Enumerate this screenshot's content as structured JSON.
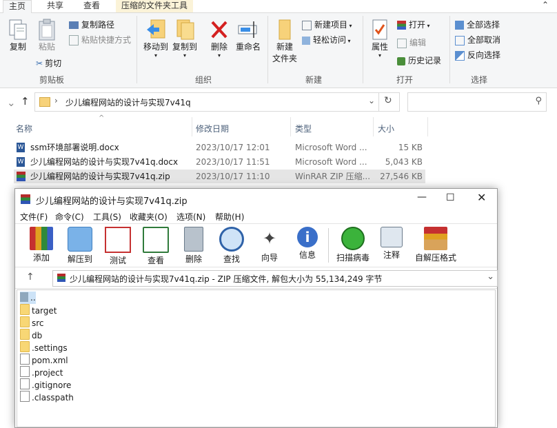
{
  "ribbon": {
    "tabs": [
      "主页",
      "共享",
      "查看",
      "压缩的文件夹工具"
    ],
    "clipboard": {
      "copy": "复制",
      "paste": "粘贴",
      "copy_path": "复制路径",
      "paste_shortcut": "粘贴快捷方式",
      "cut": "剪切",
      "group": "剪贴板"
    },
    "organize": {
      "move_to": "移动到",
      "copy_to": "复制到",
      "delete": "删除",
      "rename": "重命名",
      "group": "组织"
    },
    "new": {
      "new_folder_1": "新建",
      "new_folder_2": "文件夹",
      "new_item": "新建项目",
      "easy_access": "轻松访问",
      "group": "新建"
    },
    "open": {
      "properties": "属性",
      "open": "打开",
      "edit": "编辑",
      "history": "历史记录",
      "group": "打开"
    },
    "select": {
      "select_all": "全部选择",
      "select_none": "全部取消",
      "invert": "反向选择",
      "group": "选择"
    }
  },
  "address": {
    "path": "少儿编程网站的设计与实现7v41q"
  },
  "columns": {
    "name": "名称",
    "date": "修改日期",
    "type": "类型",
    "size": "大小"
  },
  "files": [
    {
      "name": "ssm环境部署说明.docx",
      "date": "2023/10/17 12:01",
      "type": "Microsoft Word ...",
      "size": "15 KB",
      "icon": "word-icon"
    },
    {
      "name": "少儿编程网站的设计与实现7v41q.docx",
      "date": "2023/10/17 11:51",
      "type": "Microsoft Word ...",
      "size": "5,043 KB",
      "icon": "word-icon"
    },
    {
      "name": "少儿编程网站的设计与实现7v41q.zip",
      "date": "2023/10/17 11:10",
      "type": "WinRAR ZIP 压缩...",
      "size": "27,546 KB",
      "icon": "winrar-icon"
    }
  ],
  "winrar": {
    "title": "少儿编程网站的设计与实现7v41q.zip",
    "menu": [
      "文件(F)",
      "命令(C)",
      "工具(S)",
      "收藏夹(O)",
      "选项(N)",
      "帮助(H)"
    ],
    "tools": [
      "添加",
      "解压到",
      "测试",
      "查看",
      "删除",
      "查找",
      "向导",
      "信息",
      "扫描病毒",
      "注释",
      "自解压格式"
    ],
    "path": "少儿编程网站的设计与实现7v41q.zip - ZIP 压缩文件, 解包大小为 55,134,249 字节",
    "items": [
      {
        "name": "..",
        "kind": "up"
      },
      {
        "name": "target",
        "kind": "folder"
      },
      {
        "name": "src",
        "kind": "folder"
      },
      {
        "name": "db",
        "kind": "folder"
      },
      {
        "name": ".settings",
        "kind": "folder"
      },
      {
        "name": "pom.xml",
        "kind": "xml"
      },
      {
        "name": ".project",
        "kind": "file"
      },
      {
        "name": ".gitignore",
        "kind": "file"
      },
      {
        "name": ".classpath",
        "kind": "file"
      }
    ]
  }
}
